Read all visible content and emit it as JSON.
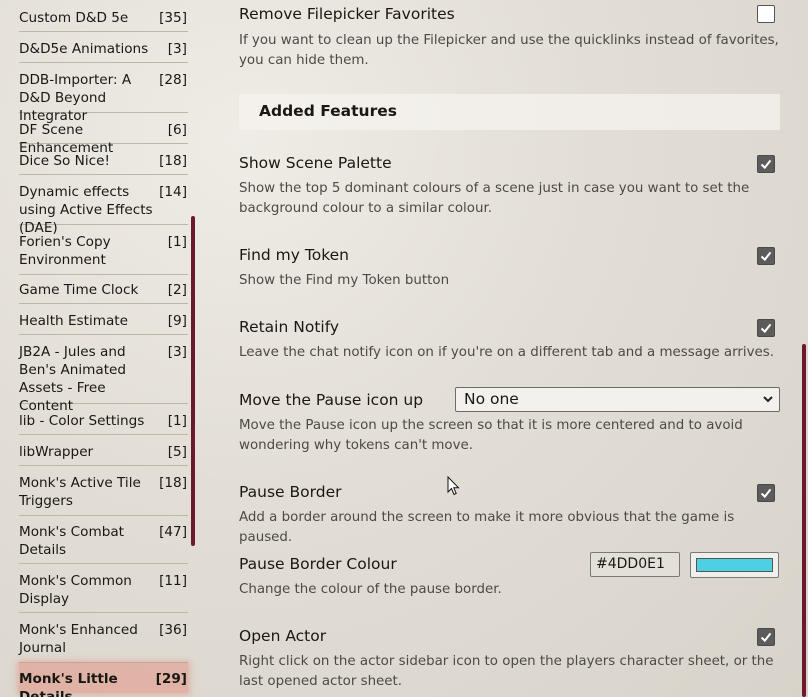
{
  "sidebar": {
    "items": [
      {
        "name": "Custom D&D 5e",
        "count": "[35]"
      },
      {
        "name": "D&D5e Animations",
        "count": "[3]"
      },
      {
        "name": "DDB-Importer: A D&D Beyond Integrator",
        "count": "[28]"
      },
      {
        "name": "DF Scene Enhancement",
        "count": "[6]"
      },
      {
        "name": "Dice So Nice!",
        "count": "[18]"
      },
      {
        "name": "Dynamic effects using Active Effects (DAE)",
        "count": "[14]"
      },
      {
        "name": "Forien's Copy Environment",
        "count": "[1]"
      },
      {
        "name": "Game Time Clock",
        "count": "[2]"
      },
      {
        "name": "Health Estimate",
        "count": "[9]"
      },
      {
        "name": "JB2A - Jules and Ben's Animated Assets - Free Content",
        "count": "[3]"
      },
      {
        "name": "lib - Color Settings",
        "count": "[1]"
      },
      {
        "name": "libWrapper",
        "count": "[5]"
      },
      {
        "name": "Monk's Active Tile Triggers",
        "count": "[18]"
      },
      {
        "name": "Monk's Combat Details",
        "count": "[47]"
      },
      {
        "name": "Monk's Common Display",
        "count": "[11]"
      },
      {
        "name": "Monk's Enhanced Journal",
        "count": "[36]"
      },
      {
        "name": "Monk's Little Details",
        "count": "[29]"
      }
    ]
  },
  "main": {
    "remove_favorites": {
      "label": "Remove Filepicker Favorites",
      "hint": "If you want to clean up the Filepicker and use the quicklinks instead of favorites, you can hide them.",
      "checked": false
    },
    "section_title": "Added Features",
    "show_palette": {
      "label": "Show Scene Palette",
      "hint": "Show the top 5 dominant colours of a scene just in case you want to set the background colour to a similar colour.",
      "checked": true
    },
    "find_token": {
      "label": "Find my Token",
      "hint": "Show the Find my Token button",
      "checked": true
    },
    "retain_notify": {
      "label": "Retain Notify",
      "hint": "Leave the chat notify icon on if you're on a different tab and a message arrives.",
      "checked": true
    },
    "move_pause": {
      "label": "Move the Pause icon up",
      "value": "No one",
      "hint": "Move the Pause icon up the screen so that it is more centered and to avoid wondering why tokens can't move."
    },
    "pause_border": {
      "label": "Pause Border",
      "hint": "Add a border around the screen to make it more obvious that the game is paused.",
      "checked": true
    },
    "pause_colour": {
      "label": "Pause Border Colour",
      "value": "#4DD0E1",
      "hint": "Change the colour of the pause border."
    },
    "open_actor": {
      "label": "Open Actor",
      "hint": "Right click on the actor sidebar icon to open the players character sheet, or the last opened actor sheet.",
      "checked": true
    }
  },
  "colors": {
    "accent_scroll": "#6b1a2c",
    "pause_border_swatch": "#4DD0E1",
    "active_item_glow": "#e66e5a"
  }
}
